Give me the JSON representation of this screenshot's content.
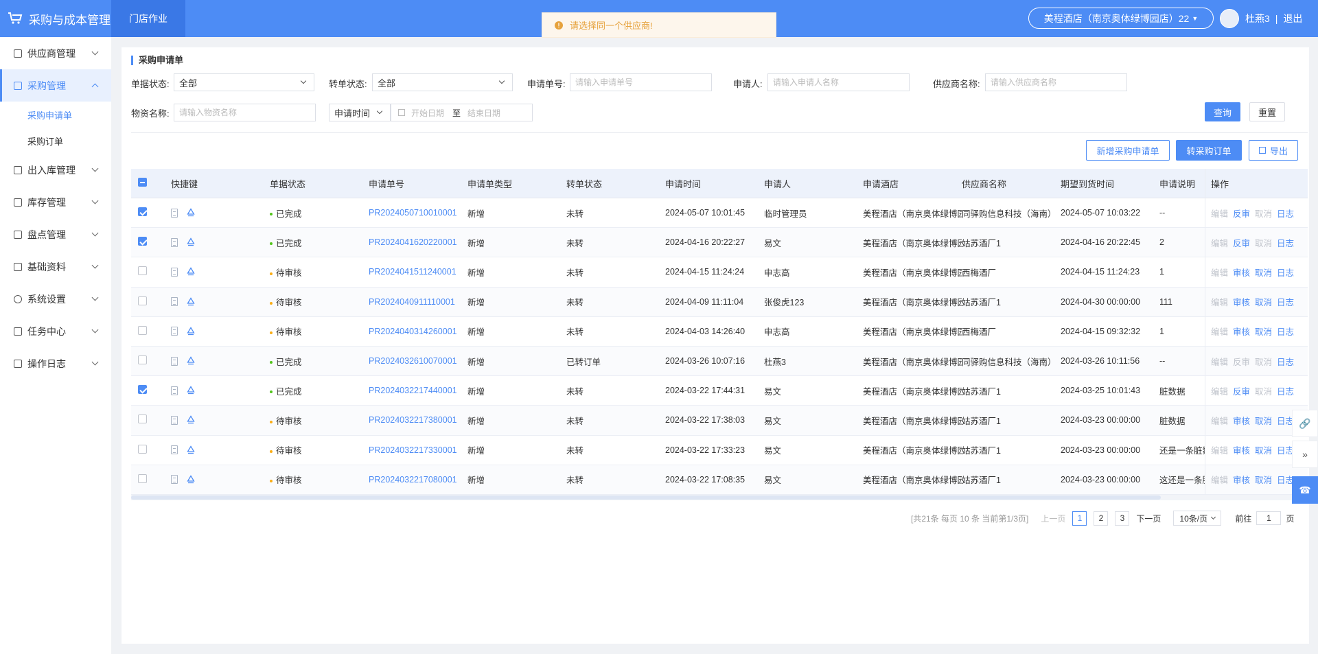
{
  "header": {
    "app_title": "采购与成本管理",
    "tab": "门店作业",
    "toast": "请选择同一个供应商!",
    "hotel_selector": "美程酒店（南京奥体绿博园店）22",
    "username": "杜燕3",
    "separator": "|",
    "logout": "退出"
  },
  "sidebar": {
    "items": [
      {
        "label": "供应商管理",
        "icon": "supplier-icon"
      },
      {
        "label": "采购管理",
        "icon": "purchase-icon",
        "active": true,
        "children": [
          {
            "label": "采购申请单",
            "active": true
          },
          {
            "label": "采购订单"
          }
        ]
      },
      {
        "label": "出入库管理",
        "icon": "inout-icon"
      },
      {
        "label": "库存管理",
        "icon": "stock-icon"
      },
      {
        "label": "盘点管理",
        "icon": "inventory-icon"
      },
      {
        "label": "基础资料",
        "icon": "basic-data-icon"
      },
      {
        "label": "系统设置",
        "icon": "settings-icon"
      },
      {
        "label": "任务中心",
        "icon": "task-icon"
      },
      {
        "label": "操作日志",
        "icon": "log-icon"
      }
    ]
  },
  "page": {
    "title": "采购申请单"
  },
  "filters": {
    "doc_status_label": "单据状态:",
    "doc_status_value": "全部",
    "transfer_status_label": "转单状态:",
    "transfer_status_value": "全部",
    "order_no_label": "申请单号:",
    "order_no_placeholder": "请输入申请单号",
    "applicant_label": "申请人:",
    "applicant_placeholder": "请输入申请人名称",
    "supplier_label": "供应商名称:",
    "supplier_placeholder": "请输入供应商名称",
    "material_label": "物资名称:",
    "material_placeholder": "请输入物资名称",
    "time_type_value": "申请时间",
    "start_date_placeholder": "开始日期",
    "to_label": "至",
    "end_date_placeholder": "结束日期",
    "query_button": "查询",
    "reset_button": "重置"
  },
  "toolbar": {
    "add_button": "新增采购申请单",
    "convert_button": "转采购订单",
    "export_button": "导出"
  },
  "table": {
    "columns": [
      "快捷键",
      "单据状态",
      "申请单号",
      "申请单类型",
      "转单状态",
      "申请时间",
      "申请人",
      "申请酒店",
      "供应商名称",
      "期望到货时间",
      "申请说明",
      "操作"
    ],
    "status_colors": {
      "已完成": "#52c41a",
      "待审核": "#faad14"
    },
    "rows": [
      {
        "checked": true,
        "status": "已完成",
        "no": "PR2024050710010001",
        "type": "新增",
        "transfer": "未转",
        "time": "2024-05-07 10:01:45",
        "applicant": "临时管理员",
        "hotel": "美程酒店（南京奥体绿博园店）",
        "supplier": "同驿购信息科技（海南）",
        "expected": "2024-05-07 10:03:22",
        "note": "--",
        "ops": [
          "编辑",
          "反审",
          "取消",
          "日志"
        ],
        "ops_enabled": [
          false,
          true,
          false,
          true
        ]
      },
      {
        "checked": true,
        "status": "已完成",
        "no": "PR2024041620220001",
        "type": "新增",
        "transfer": "未转",
        "time": "2024-04-16 20:22:27",
        "applicant": "易文",
        "hotel": "美程酒店（南京奥体绿博园店）",
        "supplier": "姑苏酒厂1",
        "expected": "2024-04-16 20:22:45",
        "note": "2",
        "ops": [
          "编辑",
          "反审",
          "取消",
          "日志"
        ],
        "ops_enabled": [
          false,
          true,
          false,
          true
        ]
      },
      {
        "checked": false,
        "status": "待审核",
        "no": "PR2024041511240001",
        "type": "新增",
        "transfer": "未转",
        "time": "2024-04-15 11:24:24",
        "applicant": "申志高",
        "hotel": "美程酒店（南京奥体绿博园店）",
        "supplier": "西梅酒厂",
        "expected": "2024-04-15 11:24:23",
        "note": "1",
        "ops": [
          "编辑",
          "审核",
          "取消",
          "日志"
        ],
        "ops_enabled": [
          false,
          true,
          true,
          true
        ]
      },
      {
        "checked": false,
        "status": "待审核",
        "no": "PR2024040911110001",
        "type": "新增",
        "transfer": "未转",
        "time": "2024-04-09 11:11:04",
        "applicant": "张俊虎123",
        "hotel": "美程酒店（南京奥体绿博园店）",
        "supplier": "姑苏酒厂1",
        "expected": "2024-04-30 00:00:00",
        "note": "111",
        "ops": [
          "编辑",
          "审核",
          "取消",
          "日志"
        ],
        "ops_enabled": [
          false,
          true,
          true,
          true
        ]
      },
      {
        "checked": false,
        "status": "待审核",
        "no": "PR2024040314260001",
        "type": "新增",
        "transfer": "未转",
        "time": "2024-04-03 14:26:40",
        "applicant": "申志高",
        "hotel": "美程酒店（南京奥体绿博园店）",
        "supplier": "西梅酒厂",
        "expected": "2024-04-15 09:32:32",
        "note": "1",
        "ops": [
          "编辑",
          "审核",
          "取消",
          "日志"
        ],
        "ops_enabled": [
          false,
          true,
          true,
          true
        ]
      },
      {
        "checked": false,
        "status": "已完成",
        "no": "PR2024032610070001",
        "type": "新增",
        "transfer": "已转订单",
        "time": "2024-03-26 10:07:16",
        "applicant": "杜燕3",
        "hotel": "美程酒店（南京奥体绿博园店）",
        "supplier": "同驿购信息科技（海南）",
        "expected": "2024-03-26 10:11:56",
        "note": "--",
        "ops": [
          "编辑",
          "反审",
          "取消",
          "日志"
        ],
        "ops_enabled": [
          false,
          false,
          false,
          true
        ]
      },
      {
        "checked": true,
        "status": "已完成",
        "no": "PR2024032217440001",
        "type": "新增",
        "transfer": "未转",
        "time": "2024-03-22 17:44:31",
        "applicant": "易文",
        "hotel": "美程酒店（南京奥体绿博园店）",
        "supplier": "姑苏酒厂1",
        "expected": "2024-03-25 10:01:43",
        "note": "脏数据",
        "ops": [
          "编辑",
          "反审",
          "取消",
          "日志"
        ],
        "ops_enabled": [
          false,
          true,
          false,
          true
        ]
      },
      {
        "checked": false,
        "status": "待审核",
        "no": "PR2024032217380001",
        "type": "新增",
        "transfer": "未转",
        "time": "2024-03-22 17:38:03",
        "applicant": "易文",
        "hotel": "美程酒店（南京奥体绿博园店）",
        "supplier": "姑苏酒厂1",
        "expected": "2024-03-23 00:00:00",
        "note": "脏数据",
        "ops": [
          "编辑",
          "审核",
          "取消",
          "日志"
        ],
        "ops_enabled": [
          false,
          true,
          true,
          true
        ]
      },
      {
        "checked": false,
        "status": "待审核",
        "no": "PR2024032217330001",
        "type": "新增",
        "transfer": "未转",
        "time": "2024-03-22 17:33:23",
        "applicant": "易文",
        "hotel": "美程酒店（南京奥体绿博园店）",
        "supplier": "姑苏酒厂1",
        "expected": "2024-03-23 00:00:00",
        "note": "还是一条脏数据",
        "ops": [
          "编辑",
          "审核",
          "取消",
          "日志"
        ],
        "ops_enabled": [
          false,
          true,
          true,
          true
        ]
      },
      {
        "checked": false,
        "status": "待审核",
        "no": "PR2024032217080001",
        "type": "新增",
        "transfer": "未转",
        "time": "2024-03-22 17:08:35",
        "applicant": "易文",
        "hotel": "美程酒店（南京奥体绿博园店）",
        "supplier": "姑苏酒厂1",
        "expected": "2024-03-23 00:00:00",
        "note": "这还是一条脏数据",
        "ops": [
          "编辑",
          "审核",
          "取消",
          "日志"
        ],
        "ops_enabled": [
          false,
          true,
          true,
          true
        ]
      }
    ]
  },
  "pagination": {
    "summary": "[共21条 每页 10 条 当前第1/3页]",
    "prev": "上一页",
    "pages": [
      "1",
      "2",
      "3"
    ],
    "current": "1",
    "next": "下一页",
    "page_size": "10条/页",
    "goto_label": "前往",
    "goto_value": "1",
    "goto_unit": "页"
  }
}
